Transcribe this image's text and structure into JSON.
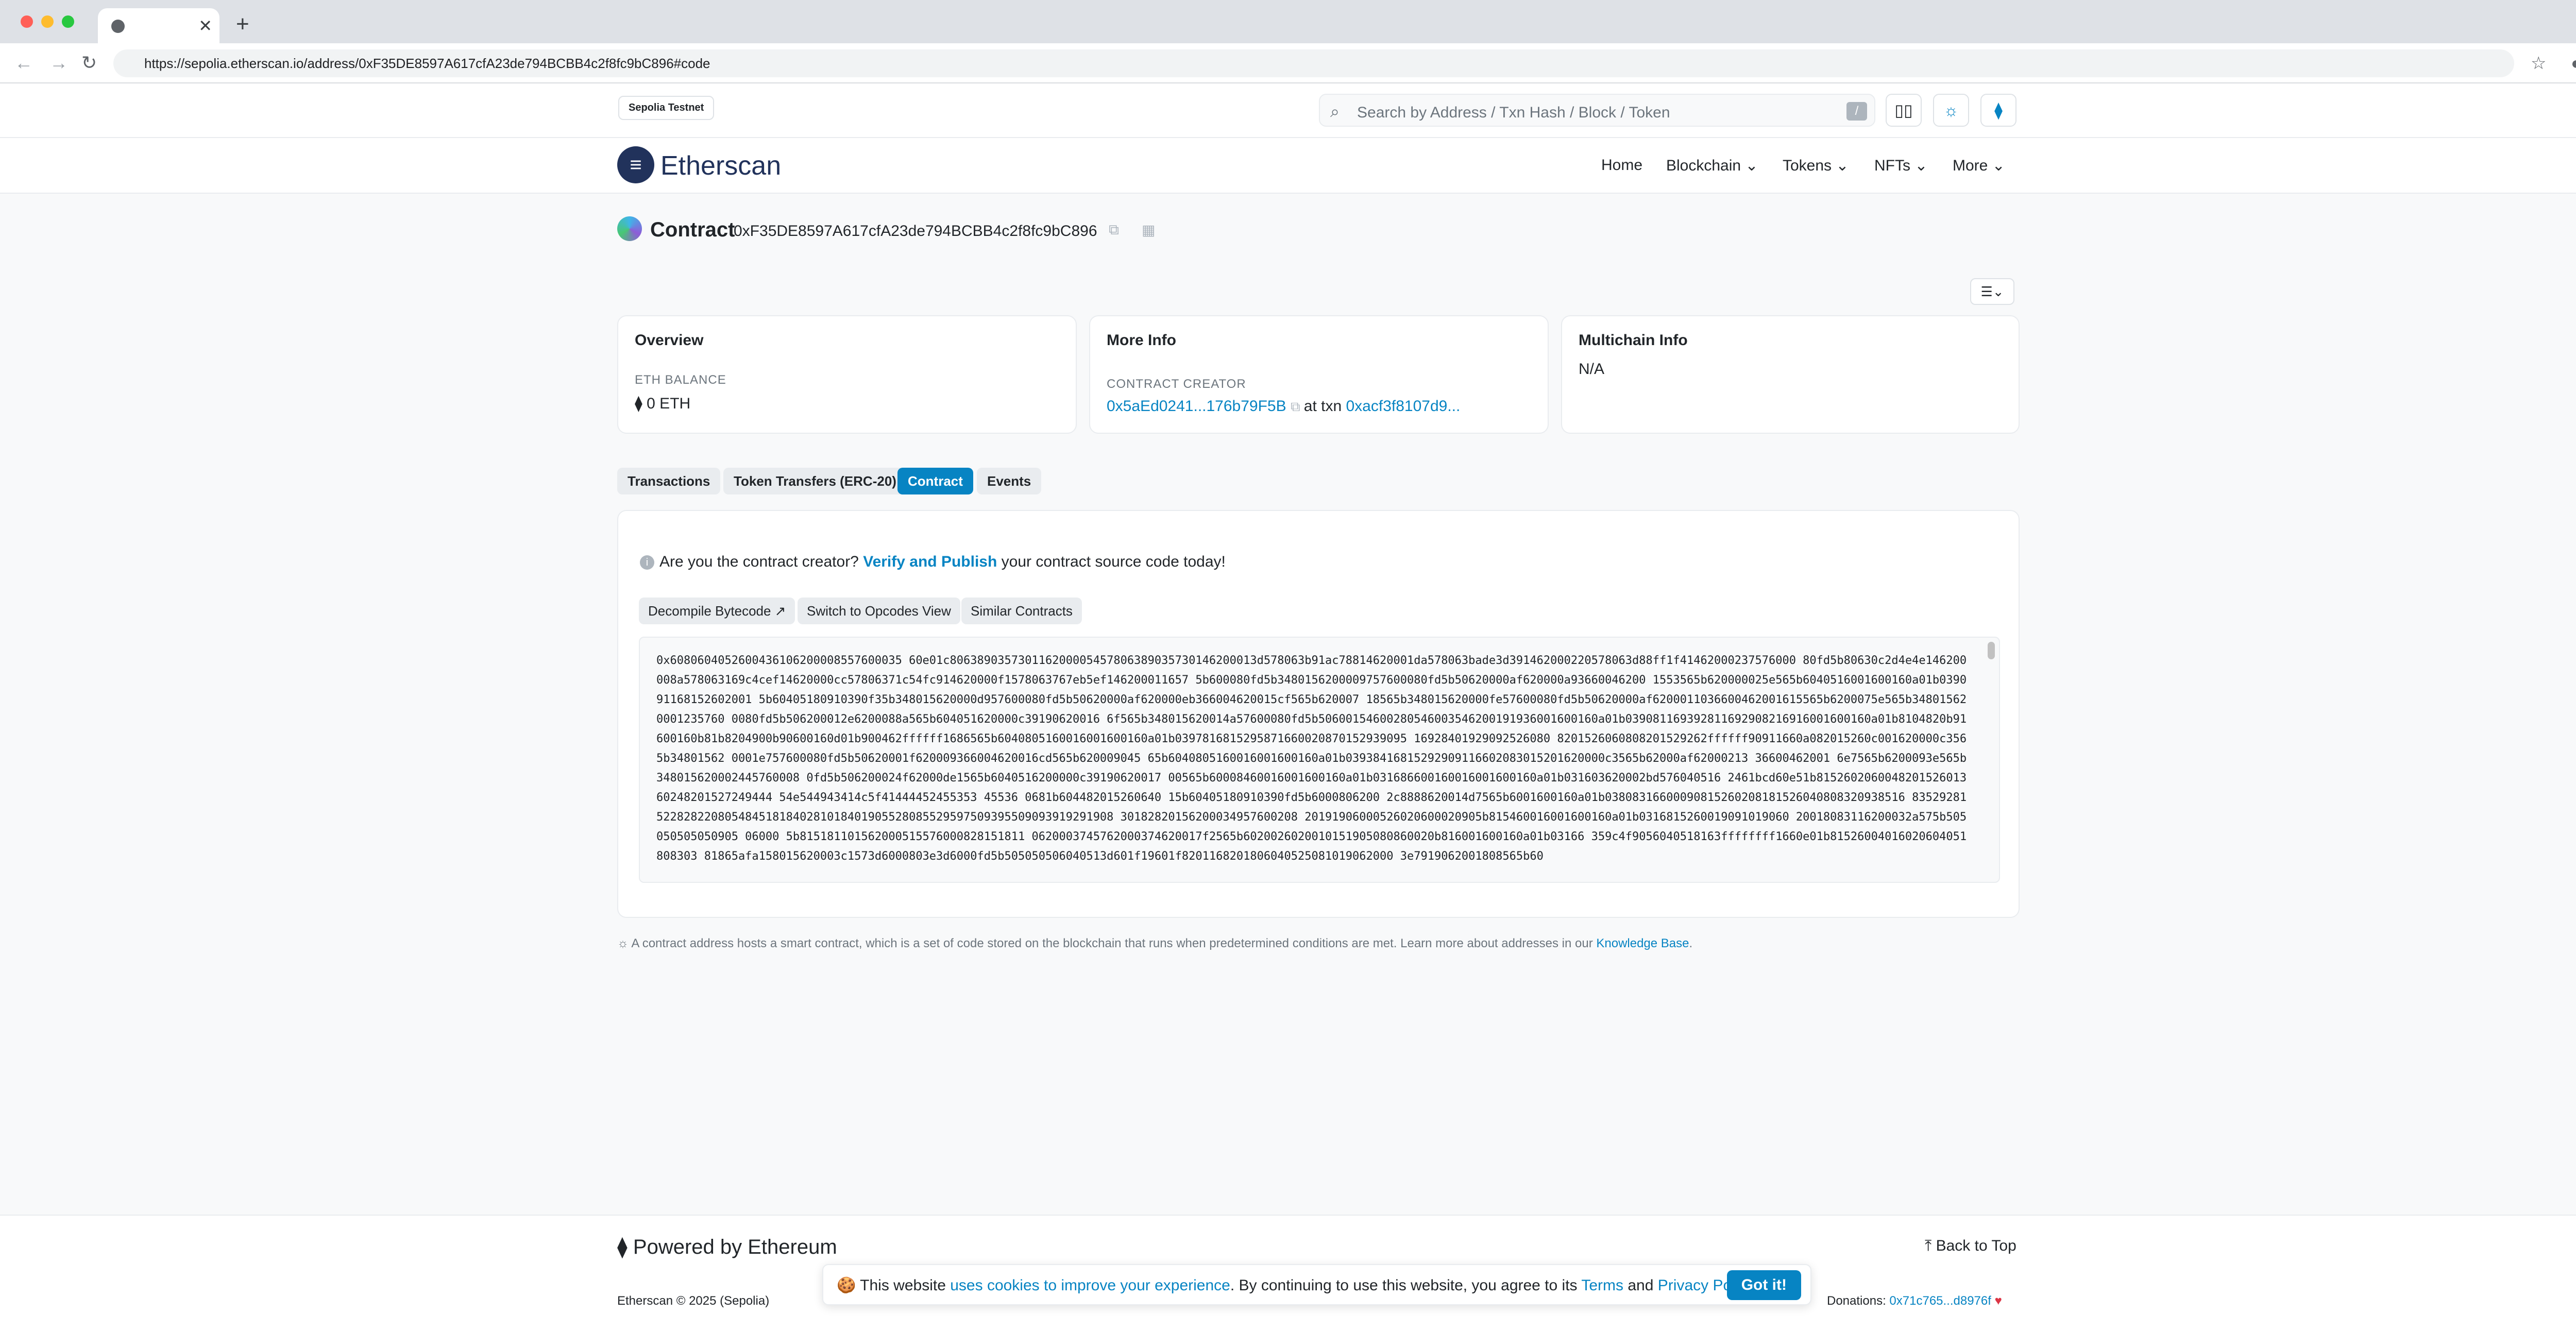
{
  "browser": {
    "url": "https://sepolia.etherscan.io/address/0xF35DE8597A617cfA23de794BCBB4c2f8fc9bC896#code",
    "new_tab": "+",
    "tab_close": "✕"
  },
  "topbar": {
    "network_badge": "Sepolia Testnet",
    "search_placeholder": "Search by Address / Txn Hash / Block / Token",
    "search_shortcut": "/"
  },
  "nav": {
    "brand": "Etherscan",
    "items": [
      {
        "label": "Home"
      },
      {
        "label": "Blockchain ⌄"
      },
      {
        "label": "Tokens ⌄"
      },
      {
        "label": "NFTs ⌄"
      },
      {
        "label": "More ⌄"
      }
    ]
  },
  "contract": {
    "title": "Contract",
    "address": "0xF35DE8597A617cfA23de794BCBB4c2f8fc9bC896"
  },
  "overview": {
    "title": "Overview",
    "balance_label": "ETH BALANCE",
    "balance_value": "⧫ 0 ETH"
  },
  "more_info": {
    "title": "More Info",
    "creator_label": "CONTRACT CREATOR",
    "creator_address": "0x5aEd0241...176b79F5B",
    "at_txn": "at txn",
    "txn_hash": "0xacf3f8107d9..."
  },
  "multichain": {
    "title": "Multichain Info",
    "value": "N/A"
  },
  "tabs": [
    {
      "label": "Transactions"
    },
    {
      "label": "Token Transfers (ERC-20)"
    },
    {
      "label": "Contract"
    },
    {
      "label": "Events"
    }
  ],
  "code_panel": {
    "notice_prefix": "Are you the contract creator?",
    "notice_link": "Verify and Publish",
    "notice_suffix": "your contract source code today!",
    "decompile_button": "Decompile Bytecode ↗",
    "opcodes_button": "Switch to Opcodes View",
    "similar_button": "Similar Contracts",
    "bytecode": "0x6080604052600436106200008557600035 60e01c806389035730116200005457806389035730146200013d578063b91ac78814620001da578063bade3d391462000220578063d88ff1f41462000237576000 80fd5b80630c2d4e4e146200008a578063169c4cef14620000cc57806371c54fc914620000f1578063767eb5ef146200011657 5b600080fd5b3480156200009757600080fd5b50620000af620000a93660046200 1553565b620000025e565b6040516001600160a01b039091168152602001 5b60405180910390f35b348015620000d957600080fd5b50620000af620000eb366004620015cf565b620007 18565b348015620000fe57600080fd5b50620000af6200011036600462001615565b6200075e565b348015620001235760 0080fd5b506200012e6200088a565b604051620000c39190620016 6f565b348015620014a57600080fd5b50600154600280546003546200191936001600160a01b039081169392811692908216916001600160a01b8104820b91600160b81b8204900b90600160d01b900462ffffff1686565b6040805160016001600160a01b0397816815295871660020870152939095 16928401929092526080 8201526060808201529262ffffff90911660a082015260c001620000c3565b34801562 0001e757600080fd5b50620001f620009366004620016cd565b620009045 65b6040805160016001600160a01b03938416815292909116602083015201620000c3565b62000af62000213 36600462001 6e7565b6200093e565b348015620002445760008 0fd5b506200024f62000de1565b6040516200000c39190620017 00565b60008460016001600160a01b031686600160016001600160a01b031603620002bd576040516 2461bcd60e51b815260206004820152601360248201527249444 54e544943414c5f41444452455353 45536 0681b604482015260640 15b60405180910390fd5b6000806200 2c8888620014d7565b6001600160a01b03808316600090815260208181526040808320938516 835292815228282208054845181840281018401905528085529597509395509093919291908 30182820156200034957600208 20191906000526020600020905b815460016001600160a01b0316815260019091019060 20018083116200032a575b505050505050905 06000 5b815181101562000515576000828151811 0620003745762000374620017f2565b6020026020010151905080860020b816001600160a01b03166 359c4f9056040518163ffffffff1660e01b81526004016020604051808303 81865afa158015620003c1573d6000803e3d6000fd5b505050506040513d601f19601f8201168201806040525081019062000 3e7919062001808565b60"
  },
  "footnote": {
    "text": "A contract address hosts a smart contract, which is a set of code stored on the blockchain that runs when predetermined conditions are met. Learn more about addresses in our",
    "link": "Knowledge Base",
    "end": "."
  },
  "footer": {
    "powered": "Powered by Ethereum",
    "back_to_top": "⤒ Back to Top",
    "copyright": "Etherscan © 2025 (Sepolia)",
    "donations_label": "Donations:",
    "donations_address": "0x71c765...d8976f",
    "heart": "♥"
  },
  "cookie": {
    "icon": "🍪",
    "prefix": "This website",
    "link1": "uses cookies to improve your experience",
    "middle": ". By continuing to use this website, you agree to its",
    "terms": "Terms",
    "and": "and",
    "privacy": "Privacy Policy",
    "end": ".",
    "button": "Got it!"
  }
}
